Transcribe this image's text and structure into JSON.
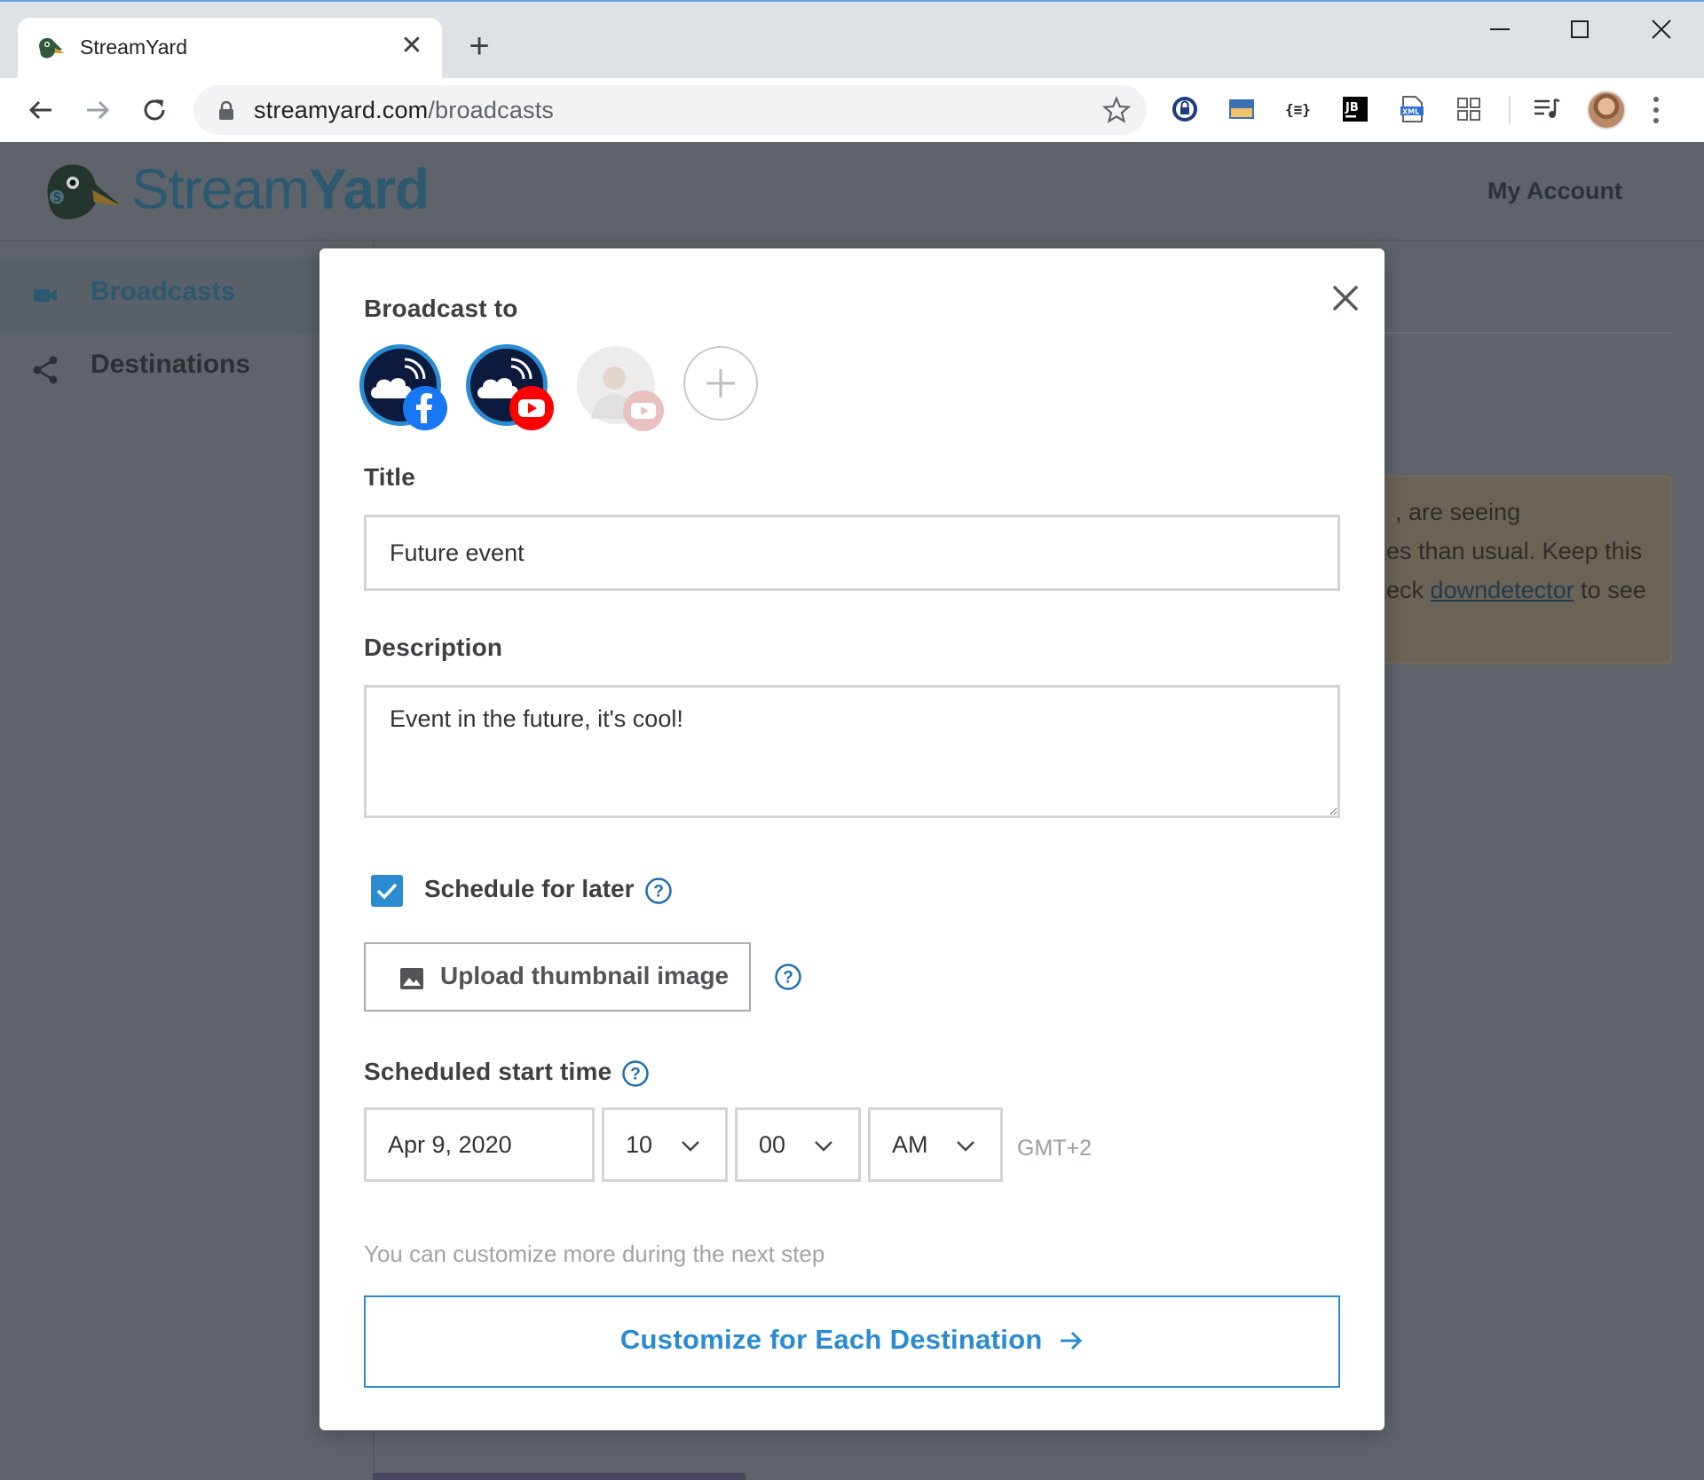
{
  "browser": {
    "tab_title": "StreamYard",
    "url_domain": "streamyard.com",
    "url_path": "/broadcasts"
  },
  "app": {
    "logo_text_light": "Stream",
    "logo_text_bold": "Yard",
    "my_account": "My Account",
    "sidebar": [
      {
        "label": "Broadcasts",
        "icon": "video-camera-icon",
        "active": true
      },
      {
        "label": "Destinations",
        "icon": "share-icon",
        "active": false
      }
    ],
    "notice_lines": [
      ", are seeing",
      "es than usual. Keep this",
      "eck"
    ],
    "notice_link": "downdetector",
    "notice_after_link": "to see"
  },
  "modal": {
    "broadcast_to_label": "Broadcast to",
    "destinations": [
      {
        "name": "facebook-destination",
        "platform": "facebook",
        "selected": true
      },
      {
        "name": "youtube-destination",
        "platform": "youtube",
        "selected": true
      },
      {
        "name": "youtube-personal-destination",
        "platform": "youtube",
        "selected": false
      }
    ],
    "title_label": "Title",
    "title_value": "Future event",
    "description_label": "Description",
    "description_value": "Event in the future, it's cool!",
    "schedule_label": "Schedule for later",
    "schedule_checked": true,
    "upload_label": "Upload thumbnail image",
    "start_time_label": "Scheduled start time",
    "date_value": "Apr 9, 2020",
    "hour_value": "10",
    "minute_value": "00",
    "ampm_value": "AM",
    "timezone": "GMT+2",
    "hint": "You can customize more during the next step",
    "cta_label": "Customize for Each Destination"
  },
  "colors": {
    "accent": "#2a8bd1",
    "overlay": "#5f646b",
    "facebook": "#1877f2",
    "youtube": "#ff0000"
  }
}
